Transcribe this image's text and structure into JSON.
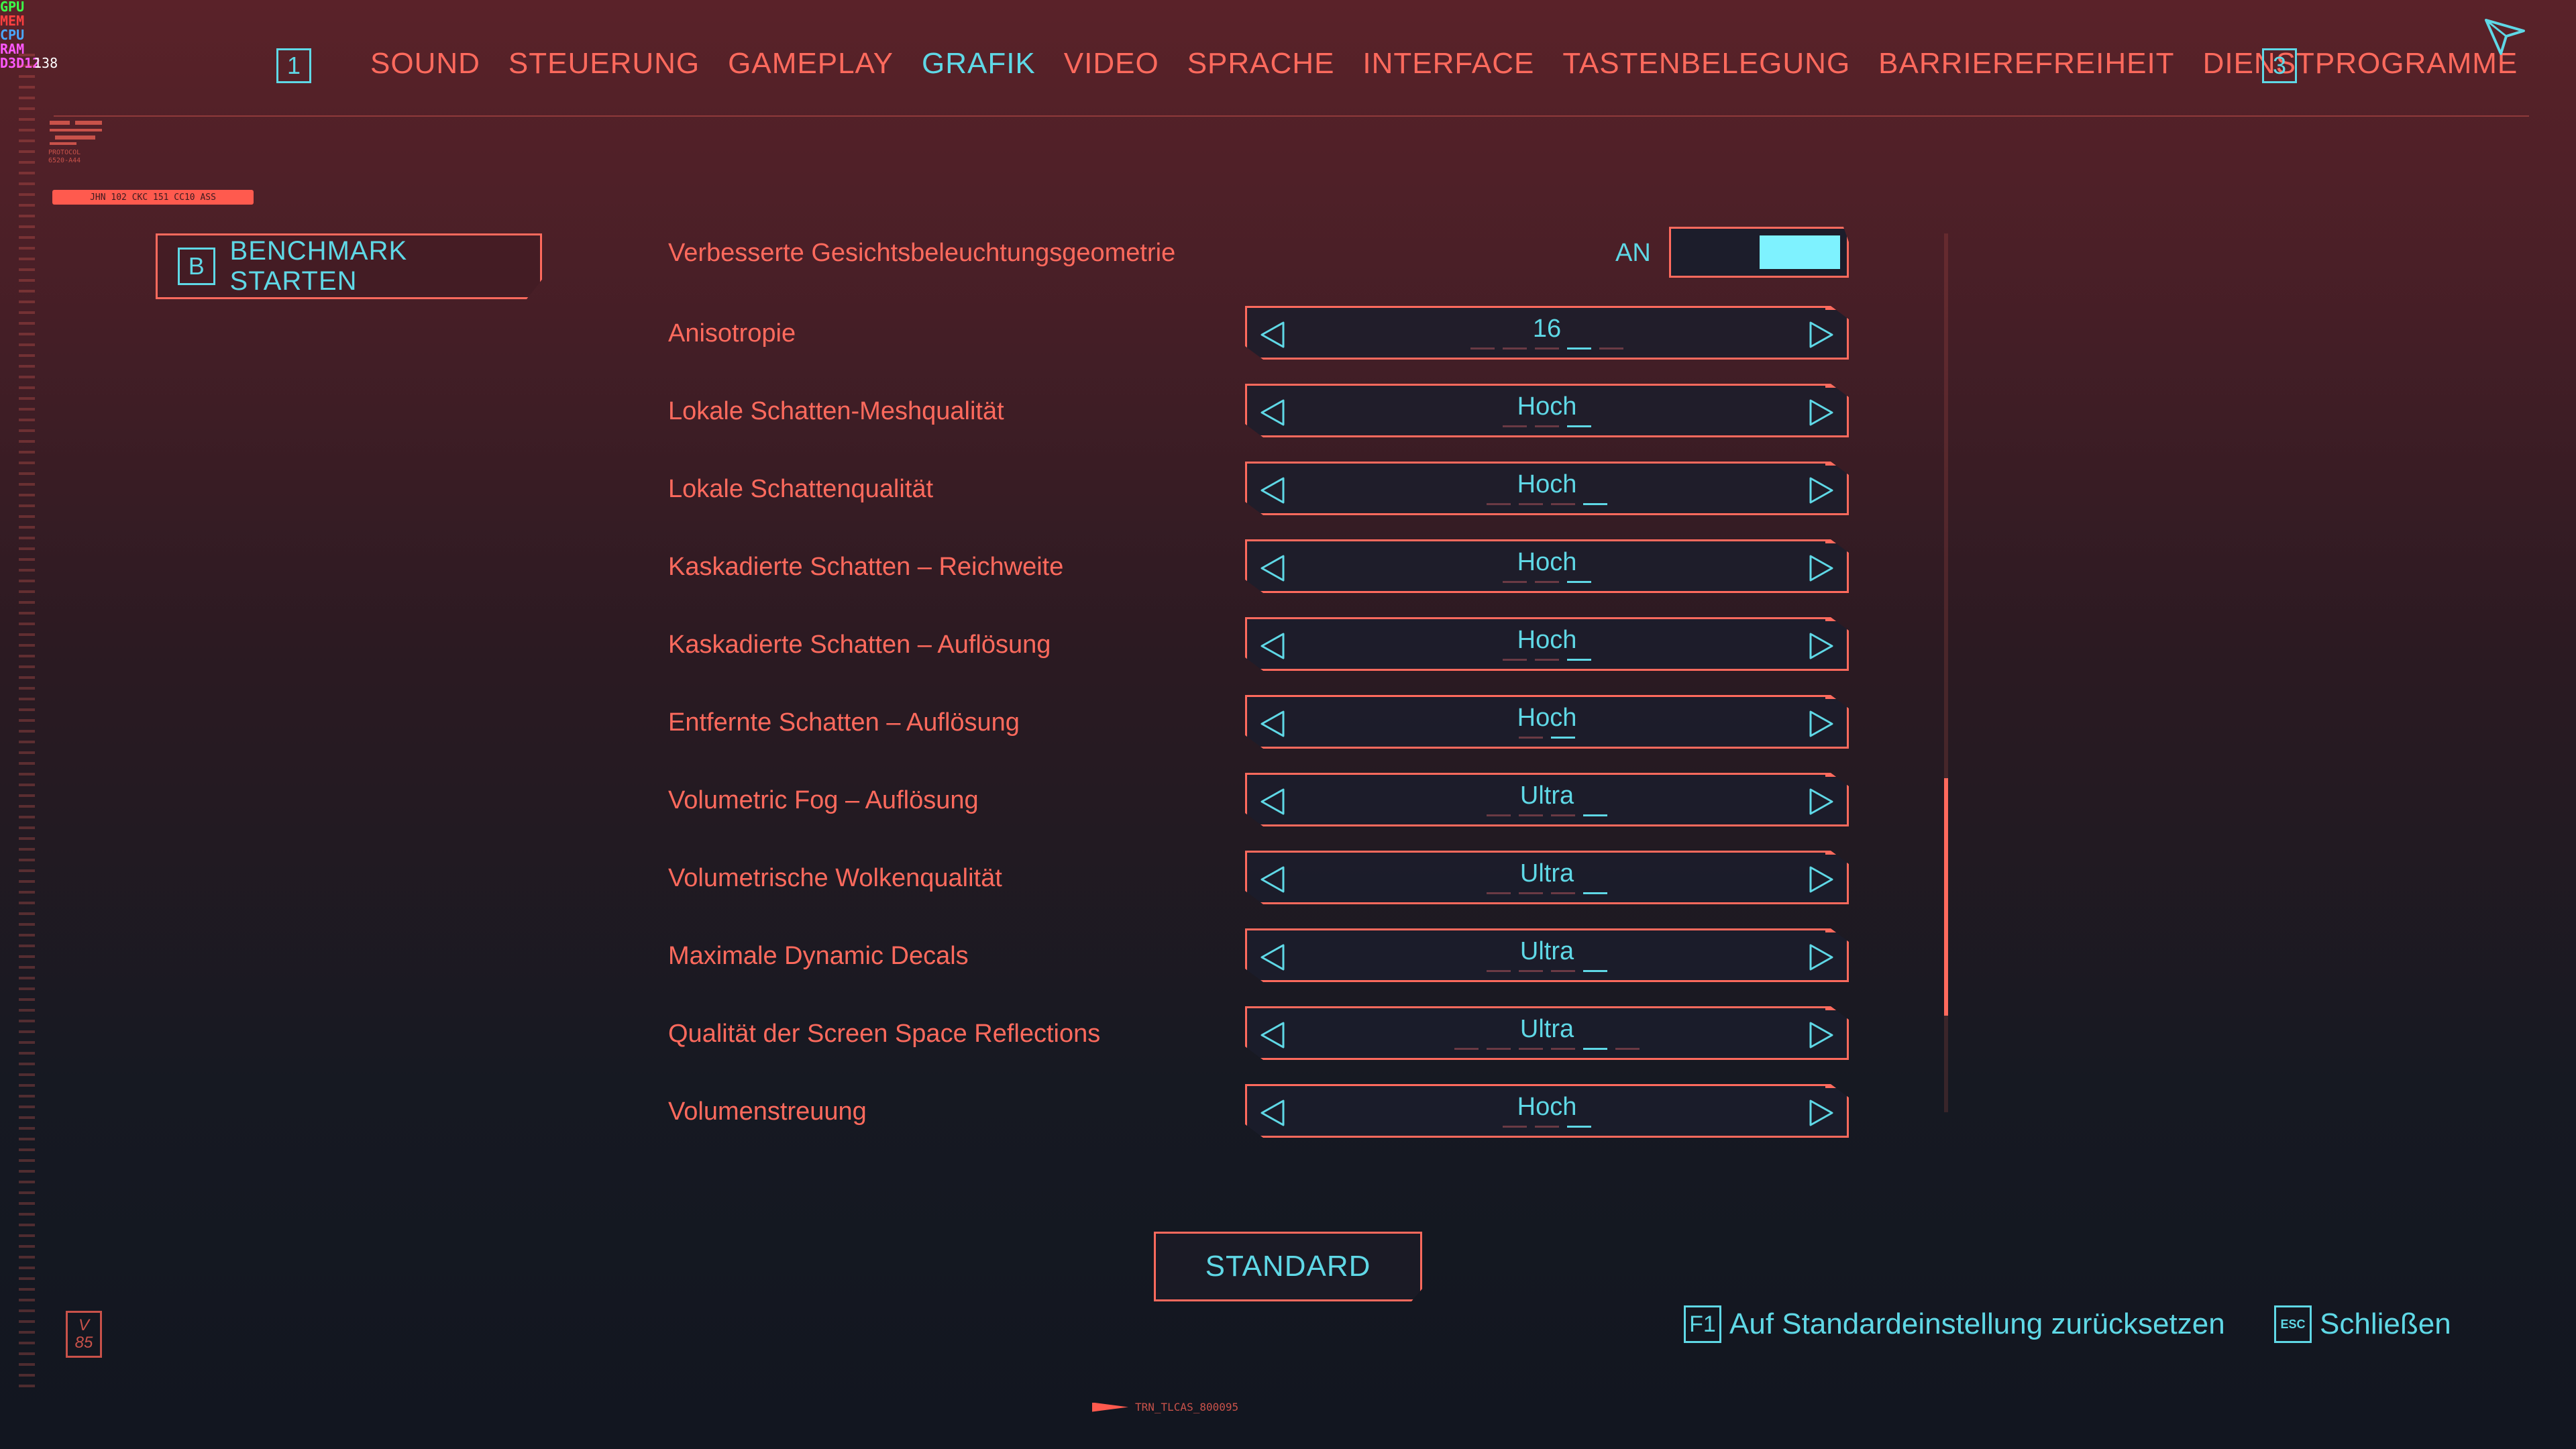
{
  "perf_overlay": [
    {
      "label": "GPU",
      "value": "",
      "color": "#3cff4a"
    },
    {
      "label": "MEM",
      "value": "",
      "color": "#ff4040"
    },
    {
      "label": "CPU",
      "value": "",
      "color": "#4aa8ff"
    },
    {
      "label": "RAM",
      "value": "",
      "color": "#ff58ff"
    },
    {
      "label": "D3D12",
      "value": "138",
      "color": "#ff58ff"
    }
  ],
  "nav": {
    "prev_key": "1",
    "next_key": "3",
    "tabs": [
      {
        "label": "SOUND"
      },
      {
        "label": "STEUERUNG"
      },
      {
        "label": "GAMEPLAY"
      },
      {
        "label": "GRAFIK",
        "active": true
      },
      {
        "label": "VIDEO"
      },
      {
        "label": "SPRACHE"
      },
      {
        "label": "INTERFACE"
      },
      {
        "label": "TASTENBELEGUNG"
      },
      {
        "label": "BARRIEREFREIHEIT"
      },
      {
        "label": "DIENSTPROGRAMME"
      }
    ],
    "cursor_icon": "cursor-arrow-icon"
  },
  "protocol": {
    "title": "PROTOCOL",
    "code": "6520-A44",
    "tag": "JHN 102 CKC 151 CC10 ASS"
  },
  "benchmark": {
    "key": "B",
    "label": "BENCHMARK STARTEN"
  },
  "toggle_setting": {
    "label": "Verbesserte Gesichtsbeleuchtungsgeometrie",
    "state_label": "AN",
    "on": true
  },
  "settings": [
    {
      "label": "Anisotropie",
      "value": "16",
      "ticks": 5,
      "active_tick": 4
    },
    {
      "label": "Lokale Schatten-Meshqualität",
      "value": "Hoch",
      "ticks": 3,
      "active_tick": 3
    },
    {
      "label": "Lokale Schattenqualität",
      "value": "Hoch",
      "ticks": 4,
      "active_tick": 4
    },
    {
      "label": "Kaskadierte Schatten – Reichweite",
      "value": "Hoch",
      "ticks": 3,
      "active_tick": 3
    },
    {
      "label": "Kaskadierte Schatten – Auflösung",
      "value": "Hoch",
      "ticks": 3,
      "active_tick": 3
    },
    {
      "label": "Entfernte Schatten – Auflösung",
      "value": "Hoch",
      "ticks": 2,
      "active_tick": 2
    },
    {
      "label": "Volumetric Fog – Auflösung",
      "value": "Ultra",
      "ticks": 4,
      "active_tick": 4
    },
    {
      "label": "Volumetrische Wolkenqualität",
      "value": "Ultra",
      "ticks": 4,
      "active_tick": 4
    },
    {
      "label": "Maximale Dynamic Decals",
      "value": "Ultra",
      "ticks": 4,
      "active_tick": 4
    },
    {
      "label": "Qualität der Screen Space Reflections",
      "value": "Ultra",
      "ticks": 6,
      "active_tick": 5
    },
    {
      "label": "Volumenstreuung",
      "value": "Hoch",
      "ticks": 3,
      "active_tick": 3
    }
  ],
  "scrollbar": {
    "thumb_start": 0.62,
    "thumb_size": 0.27
  },
  "standard_button": {
    "label": "STANDARD"
  },
  "footer": {
    "reset_key": "F1",
    "reset_label": "Auf Standardeinstellung zurücksetzen",
    "close_key": "ESC",
    "close_label": "Schließen",
    "version_top": "V",
    "version_bottom": "85",
    "trn_id": "TRN_TLCAS_800095"
  },
  "colors": {
    "accent": "#5fd8e6",
    "primary": "#ff6a5d",
    "toggle_fill": "#7ef2ff"
  }
}
